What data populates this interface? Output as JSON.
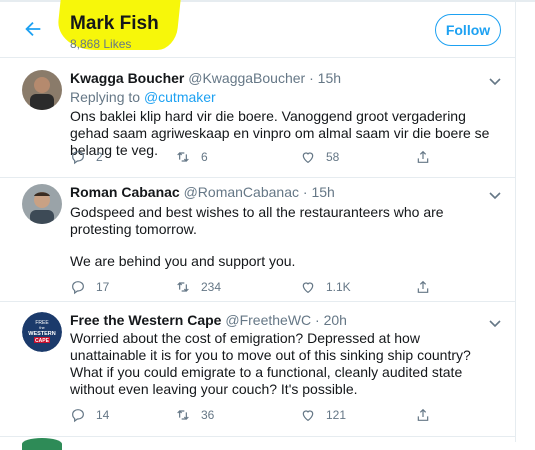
{
  "header": {
    "title": "Mark Fish",
    "subtitle": "8,868 Likes",
    "follow_label": "Follow"
  },
  "tweets": [
    {
      "name": "Kwagga Boucher",
      "handle": "@KwaggaBoucher",
      "sep": " · ",
      "time": "15h",
      "reply_prefix": "Replying to ",
      "reply_to": "@cutmaker",
      "text": "Ons baklei klip hard vir die boere. Vanoggend groot vergadering gehad saam agriweskaap en vinpro om almal saam vir die boere se belang te veg.",
      "replies": "2",
      "retweets": "6",
      "likes": "58"
    },
    {
      "name": "Roman Cabanac",
      "handle": "@RomanCabanac",
      "sep": " · ",
      "time": "15h",
      "text1": "Godspeed and best wishes to all the restauranteers who are protesting tomorrow.",
      "text2": "We are behind you and support you.",
      "replies": "17",
      "retweets": "234",
      "likes": "1.1K"
    },
    {
      "name": "Free the Western Cape",
      "handle": "@FreetheWC",
      "sep": " · ",
      "time": "20h",
      "avatar_lines": [
        "FREE",
        "the",
        "WESTERN",
        "CAPE"
      ],
      "text": "Worried about the cost of emigration? Depressed at how unattainable it is for you to move out of this sinking ship country? What if you could emigrate to a functional, cleanly audited state without even leaving your couch? It's possible.",
      "replies": "14",
      "retweets": "36",
      "likes": "121"
    }
  ],
  "colors": {
    "accent": "#1da1f2",
    "highlight": "#f7f70a",
    "muted": "#657786"
  }
}
